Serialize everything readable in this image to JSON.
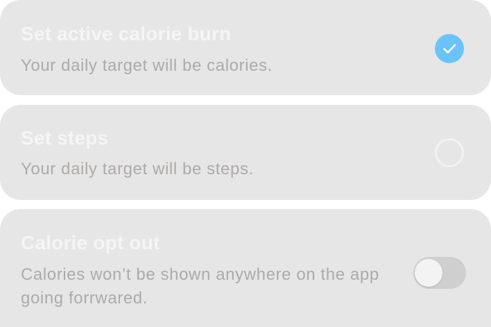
{
  "options": [
    {
      "title": "Set active calorie burn",
      "description": "Your daily target will be calories.",
      "control": "radio",
      "selected": true
    },
    {
      "title": "Set steps",
      "description": "Your daily target will be steps.",
      "control": "radio",
      "selected": false
    },
    {
      "title": "Calorie opt out",
      "description": "Calories won’t be shown anywhere on the app going forrwared.",
      "control": "toggle",
      "enabled": false
    }
  ],
  "colors": {
    "card_background": "#e6e6e6",
    "title_text": "#f5f5f5",
    "description_text": "#aeaaa8",
    "radio_selected": "#6ac4fb",
    "radio_unselected_border": "#f2f2f2",
    "toggle_track_off": "#cfcfcf",
    "toggle_knob": "#f3f3f3"
  },
  "icons": {
    "selected_radio": "checkmark-icon"
  }
}
